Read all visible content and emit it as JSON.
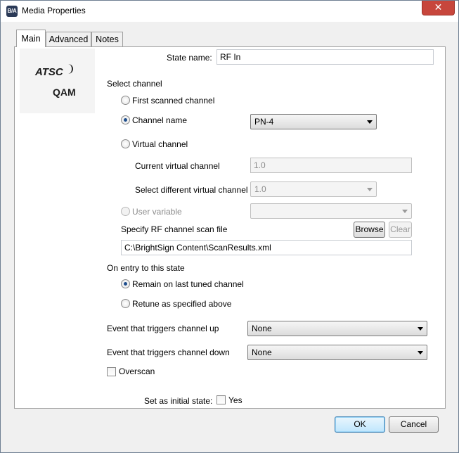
{
  "window": {
    "title": "Media Properties",
    "icon_text": "B/A",
    "close_glyph": "✕"
  },
  "tabs": [
    {
      "label": "Main",
      "active": true
    },
    {
      "label": "Advanced",
      "active": false
    },
    {
      "label": "Notes",
      "active": false
    }
  ],
  "logo": {
    "line1": "ATSC",
    "line2": "QAM"
  },
  "state_name": {
    "label": "State name:",
    "value": "RF In"
  },
  "select_channel": {
    "heading": "Select channel",
    "first_scanned": {
      "label": "First scanned channel",
      "checked": false
    },
    "channel_name": {
      "label": "Channel name",
      "checked": true,
      "selected": "PN-4"
    },
    "virtual_channel": {
      "label": "Virtual channel",
      "checked": false
    },
    "current_virtual": {
      "label": "Current virtual channel",
      "value": "1.0"
    },
    "different_virtual": {
      "label": "Select different virtual channel",
      "selected": "1.0"
    },
    "user_variable": {
      "label": "User variable",
      "checked": false,
      "selected": ""
    },
    "scan_file": {
      "label": "Specify RF channel scan file",
      "value": "C:\\BrightSign Content\\ScanResults.xml",
      "browse": "Browse",
      "clear": "Clear"
    }
  },
  "on_entry": {
    "heading": "On entry to this state",
    "remain": {
      "label": "Remain on last tuned channel",
      "checked": true
    },
    "retune": {
      "label": "Retune as specified above",
      "checked": false
    }
  },
  "triggers": {
    "up": {
      "label": "Event that triggers channel up",
      "selected": "None"
    },
    "down": {
      "label": "Event that triggers channel down",
      "selected": "None"
    }
  },
  "overscan": {
    "label": "Overscan",
    "checked": false
  },
  "initial_state": {
    "label": "Set as initial state:",
    "checkbox_label": "Yes",
    "checked": false
  },
  "footer": {
    "ok": "OK",
    "cancel": "Cancel"
  }
}
